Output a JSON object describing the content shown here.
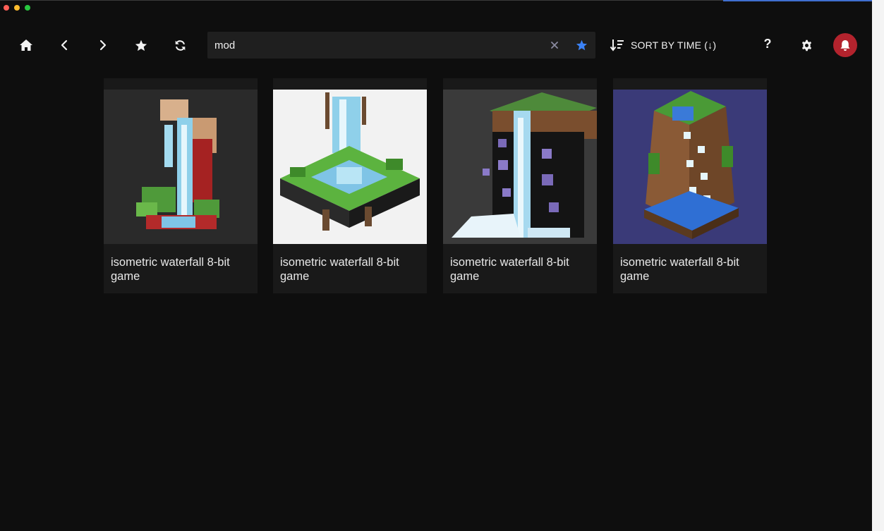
{
  "toolbar": {
    "home_icon": "home-icon",
    "back_icon": "chevron-left-icon",
    "forward_icon": "chevron-right-icon",
    "favorites_icon": "star-icon",
    "refresh_icon": "refresh-icon",
    "help_label": "?",
    "settings_icon": "gear-icon",
    "notifications_icon": "bell-icon",
    "notification_color": "#b3232d"
  },
  "search": {
    "value": "mod",
    "clear_icon": "close-icon",
    "favorite_icon": "star-icon",
    "favorite_color": "#3b82f6"
  },
  "sort": {
    "label": "SORT BY TIME (↓)",
    "icon": "sort-descending-icon"
  },
  "cards": [
    {
      "caption": "isometric waterfall 8-bit game",
      "background": "#2a2a2a"
    },
    {
      "caption": "isometric waterfall 8-bit game",
      "background": "#f2f2f2"
    },
    {
      "caption": "isometric waterfall 8-bit game",
      "background": "#3a3a3a"
    },
    {
      "caption": "isometric waterfall 8-bit game",
      "background": "#3a3a78"
    }
  ]
}
